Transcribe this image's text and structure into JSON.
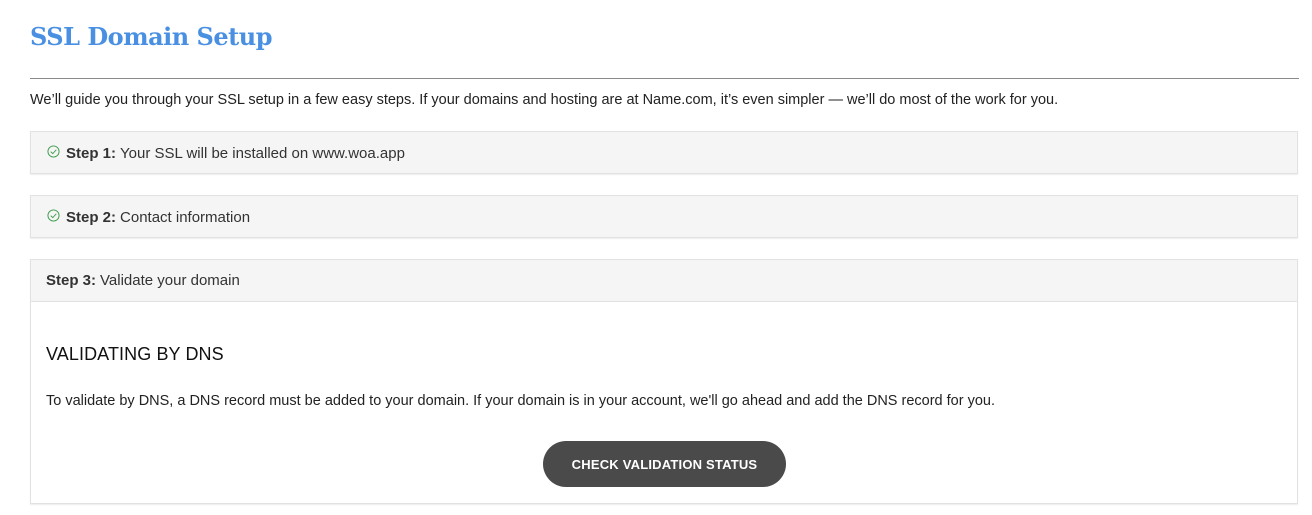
{
  "page": {
    "title": "SSL Domain Setup",
    "intro": "We’ll guide you through your SSL setup in a few easy steps. If your domains and hosting are at Name.com, it’s even simpler — we’ll do most of the work for you."
  },
  "steps": [
    {
      "number_label": "Step 1:",
      "title": "Your SSL will be installed on www.woa.app",
      "completed": true,
      "icon": "check-circle-icon"
    },
    {
      "number_label": "Step 2:",
      "title": "Contact information",
      "completed": true,
      "icon": "check-circle-icon"
    },
    {
      "number_label": "Step 3:",
      "title": "Validate your domain",
      "completed": false,
      "expanded": true,
      "content": {
        "heading": "VALIDATING BY DNS",
        "description": "To validate by DNS, a DNS record must be added to your domain. If your domain is in your account, we'll go ahead and add the DNS record for you.",
        "button_label": "CHECK VALIDATION STATUS"
      }
    }
  ],
  "colors": {
    "title": "#4a90e2",
    "check_icon": "#3a9a4a",
    "button_bg": "#4a4a4a",
    "panel_bg": "#f5f5f5"
  }
}
